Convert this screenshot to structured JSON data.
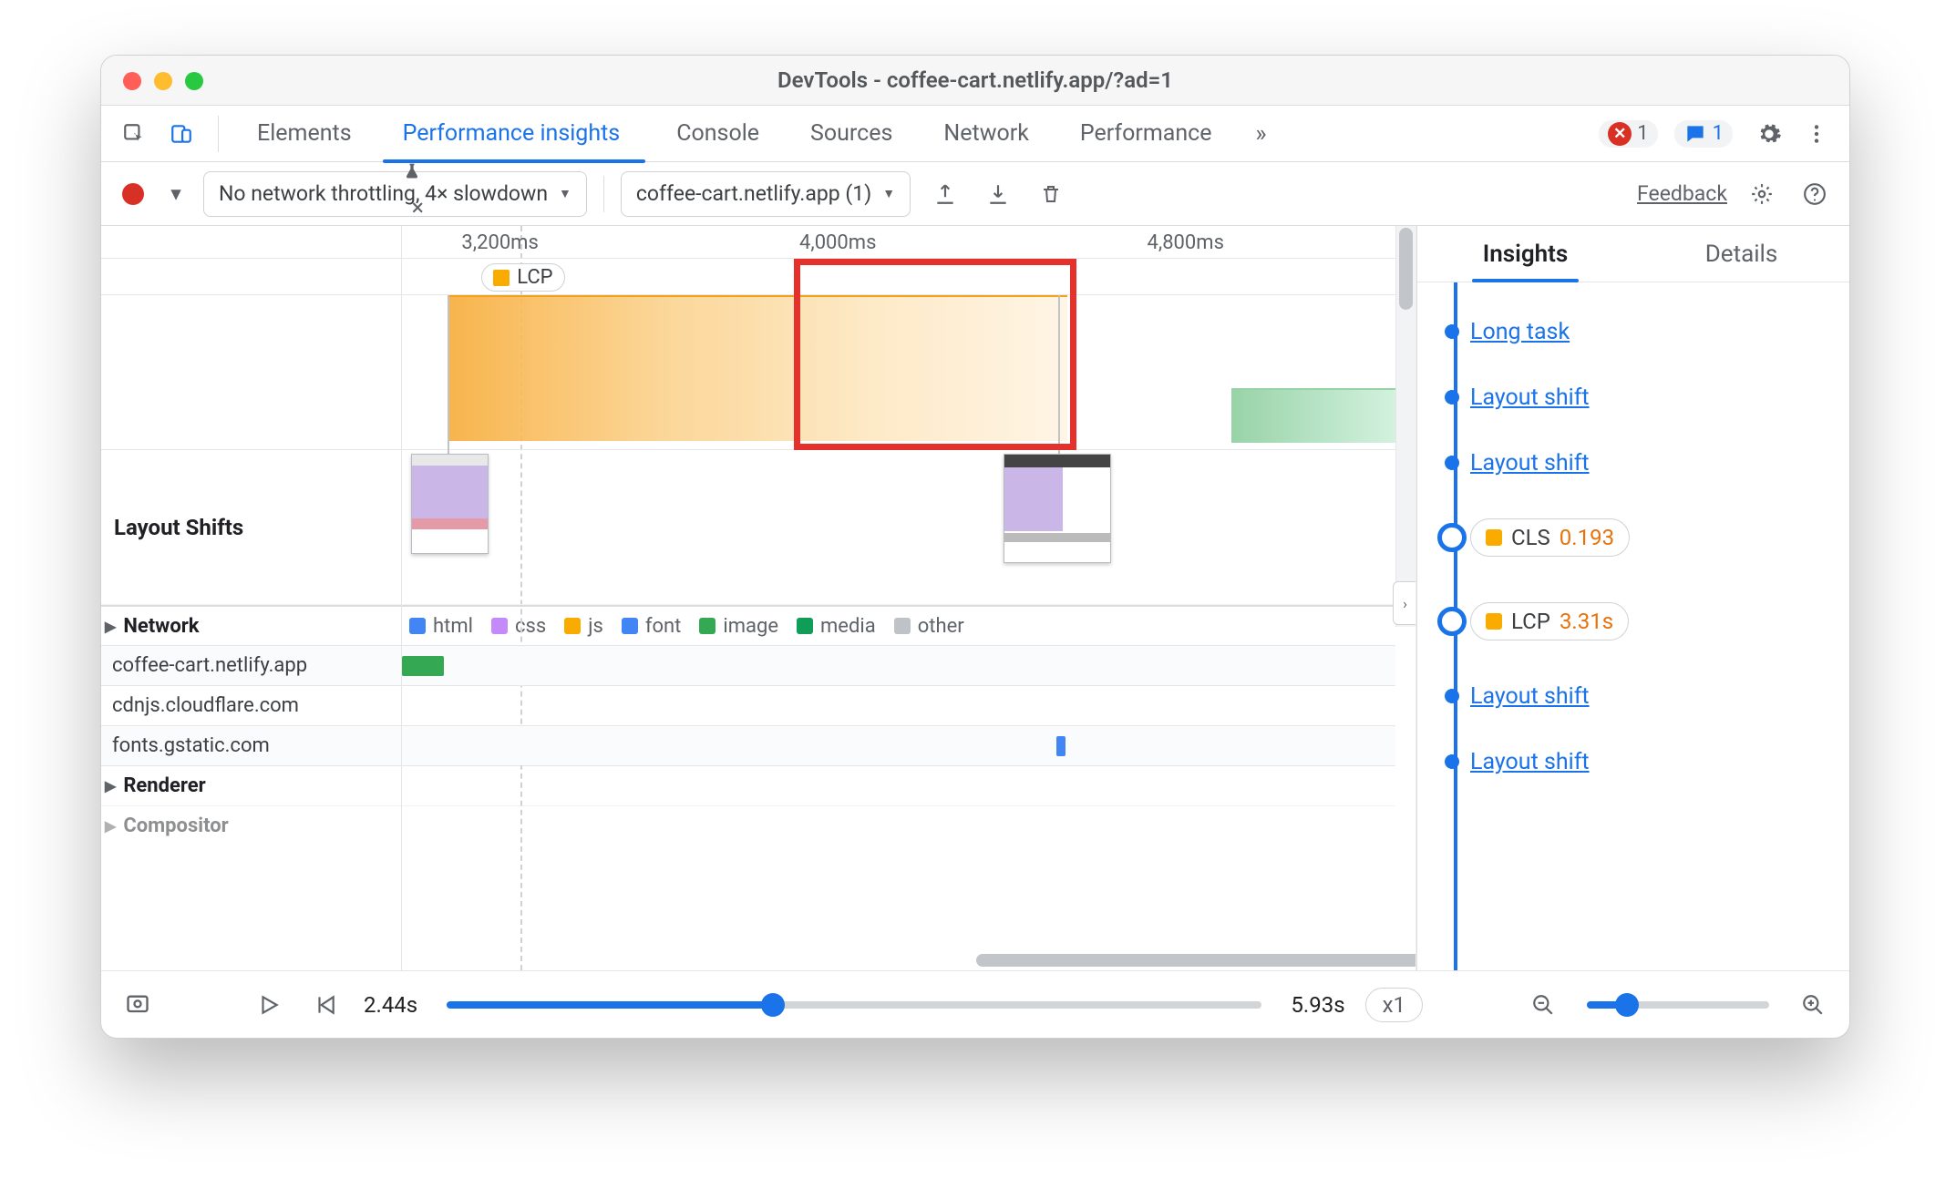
{
  "window": {
    "title": "DevTools - coffee-cart.netlify.app/?ad=1"
  },
  "tabs": {
    "items": [
      "Elements",
      "Performance insights",
      "Console",
      "Sources",
      "Network",
      "Performance"
    ],
    "active_index": 1,
    "overflow_glyph": "»",
    "close_glyph": "×"
  },
  "badges": {
    "errors": "1",
    "messages": "1"
  },
  "subtoolbar": {
    "throttling_label": "No network throttling, 4× slowdown",
    "session_label": "coffee-cart.netlify.app (1)",
    "feedback_label": "Feedback"
  },
  "timeline": {
    "ticks": [
      {
        "pos_pct": 6,
        "label": "3,200ms"
      },
      {
        "pos_pct": 40,
        "label": "4,000ms"
      },
      {
        "pos_pct": 75,
        "label": "4,800ms"
      }
    ],
    "lcp_marker_label": "LCP",
    "row_labels": {
      "layout_shifts": "Layout Shifts",
      "network": "Network",
      "renderer": "Renderer",
      "compositor": "Compositor"
    },
    "legend": [
      {
        "key": "html",
        "label": "html"
      },
      {
        "key": "css",
        "label": "css"
      },
      {
        "key": "js",
        "label": "js"
      },
      {
        "key": "font",
        "label": "font"
      },
      {
        "key": "image",
        "label": "image"
      },
      {
        "key": "media",
        "label": "media"
      },
      {
        "key": "other",
        "label": "other"
      }
    ],
    "network_rows": [
      "coffee-cart.netlify.app",
      "cdnjs.cloudflare.com",
      "fonts.gstatic.com"
    ]
  },
  "insights": {
    "tabs": {
      "insights": "Insights",
      "details": "Details"
    },
    "items": [
      {
        "kind": "link",
        "label": "Long task"
      },
      {
        "kind": "link",
        "label": "Layout shift"
      },
      {
        "kind": "link",
        "label": "Layout shift"
      },
      {
        "kind": "metric",
        "name": "CLS",
        "value": "0.193",
        "color": "#f9ab00"
      },
      {
        "kind": "metric",
        "name": "LCP",
        "value": "3.31s",
        "color": "#f9ab00"
      },
      {
        "kind": "link",
        "label": "Layout shift"
      },
      {
        "kind": "link",
        "label": "Layout shift"
      }
    ]
  },
  "footer": {
    "start_label": "2.44s",
    "end_label": "5.93s",
    "speed_label": "x1",
    "play_progress_pct": 40,
    "zoom_progress_pct": 22
  }
}
